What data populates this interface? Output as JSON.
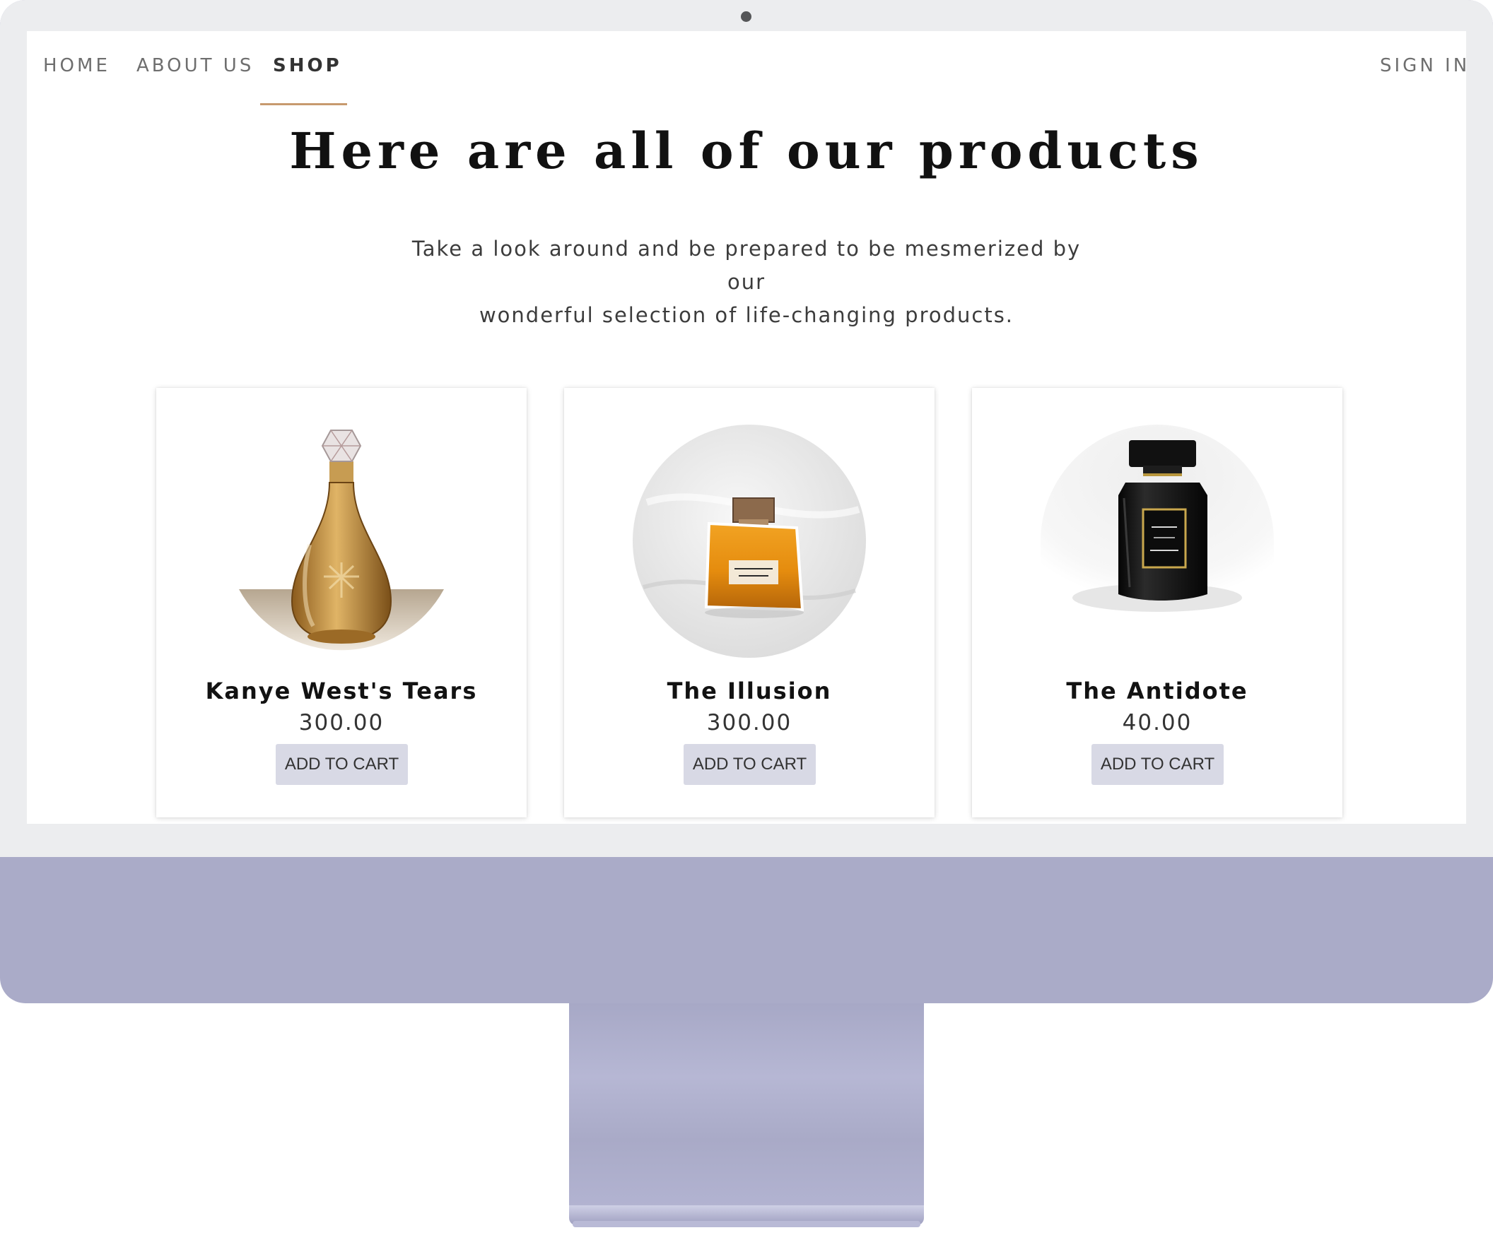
{
  "nav": {
    "links": [
      {
        "label": "HOME"
      },
      {
        "label": "ABOUT US"
      },
      {
        "label": "SHOP"
      }
    ],
    "active": "SHOP",
    "sign_in": "SIGN IN",
    "accent_color": "#c79a6e"
  },
  "hero": {
    "title": "Here are all of our products",
    "subtitle_line1": "Take a look around and be prepared to be mesmerized by our",
    "subtitle_line2": "wonderful selection of life-changing products."
  },
  "products": [
    {
      "name": "Kanye West's Tears",
      "price": "300.00",
      "button": "ADD TO CART",
      "image": "amber-glass-decanter-perfume-photo"
    },
    {
      "name": "The Illusion",
      "price": "300.00",
      "button": "ADD TO CART",
      "image": "gold-perfume-bottle-on-white-silk-photo"
    },
    {
      "name": "The Antidote",
      "price": "40.00",
      "button": "ADD TO CART",
      "image": "black-perfume-bottle-photo"
    }
  ],
  "device": {
    "frame_color": "#aaabc8",
    "bezel_color": "#ecedef"
  }
}
